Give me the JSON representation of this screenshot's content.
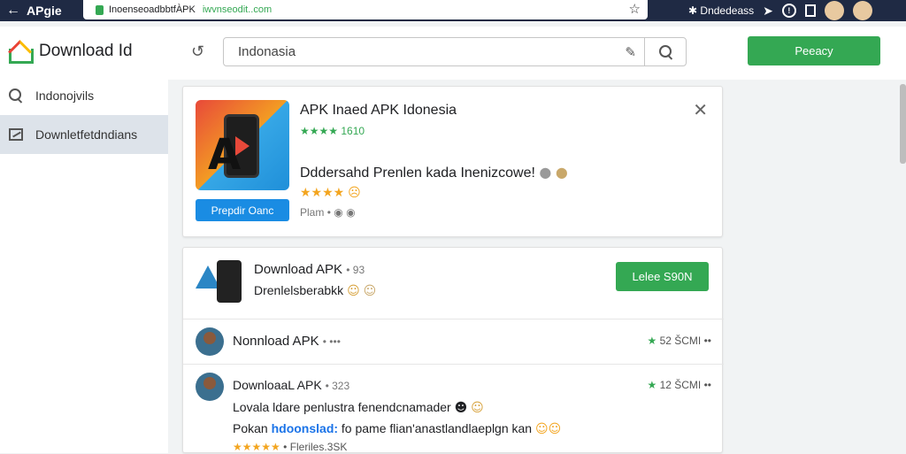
{
  "browser": {
    "brand": "APgie",
    "url_path": "InoenseoadbbtfÀPK",
    "url_host": "iwvnseodit..com",
    "profile_label": "Dndedeass"
  },
  "sidebar": {
    "logo_text": "Download Id",
    "items": [
      {
        "label": "Indonojvils",
        "icon": "search-icon",
        "active": false
      },
      {
        "label": "Downletfetdndians",
        "icon": "box-icon",
        "active": true
      }
    ]
  },
  "header": {
    "search_value": "Indonasia",
    "primary_button": "Peeacy"
  },
  "featured": {
    "title": "APK Inaed APK Idonesia",
    "rating": "★★★★ 1610",
    "install_button": "Prepdir Oanc",
    "description": "Dddersahd Prenlen kada Inenizcowe!",
    "stars": "★★★★",
    "meta": "Plam"
  },
  "list": {
    "row1": {
      "title": "Download APK",
      "title_suffix": "• 93",
      "subtitle": "Drenlelsberabkk",
      "button": "Lelee S90N"
    },
    "row2": {
      "title": "Nonnload APK",
      "dots": "• •••",
      "score": "52 ŠCMI",
      "more": "••"
    },
    "row3": {
      "title": "DownloaaL APK",
      "title_suffix": "• 323",
      "score": "12 ŠCMI",
      "more": "••",
      "line1": "Lovala ldare penlustra fenendcnamader",
      "line2_prefix": "Pokan",
      "line2_link": "hdoonslad:",
      "line2_rest": "fo pame flian'anastlandlaeplgn kan",
      "stars": "★★★★★",
      "line3": "Fleriles.3SK"
    }
  },
  "colors": {
    "accent_green": "#34a853",
    "accent_blue": "#1a8ce3",
    "topbar": "#1f2a44"
  }
}
